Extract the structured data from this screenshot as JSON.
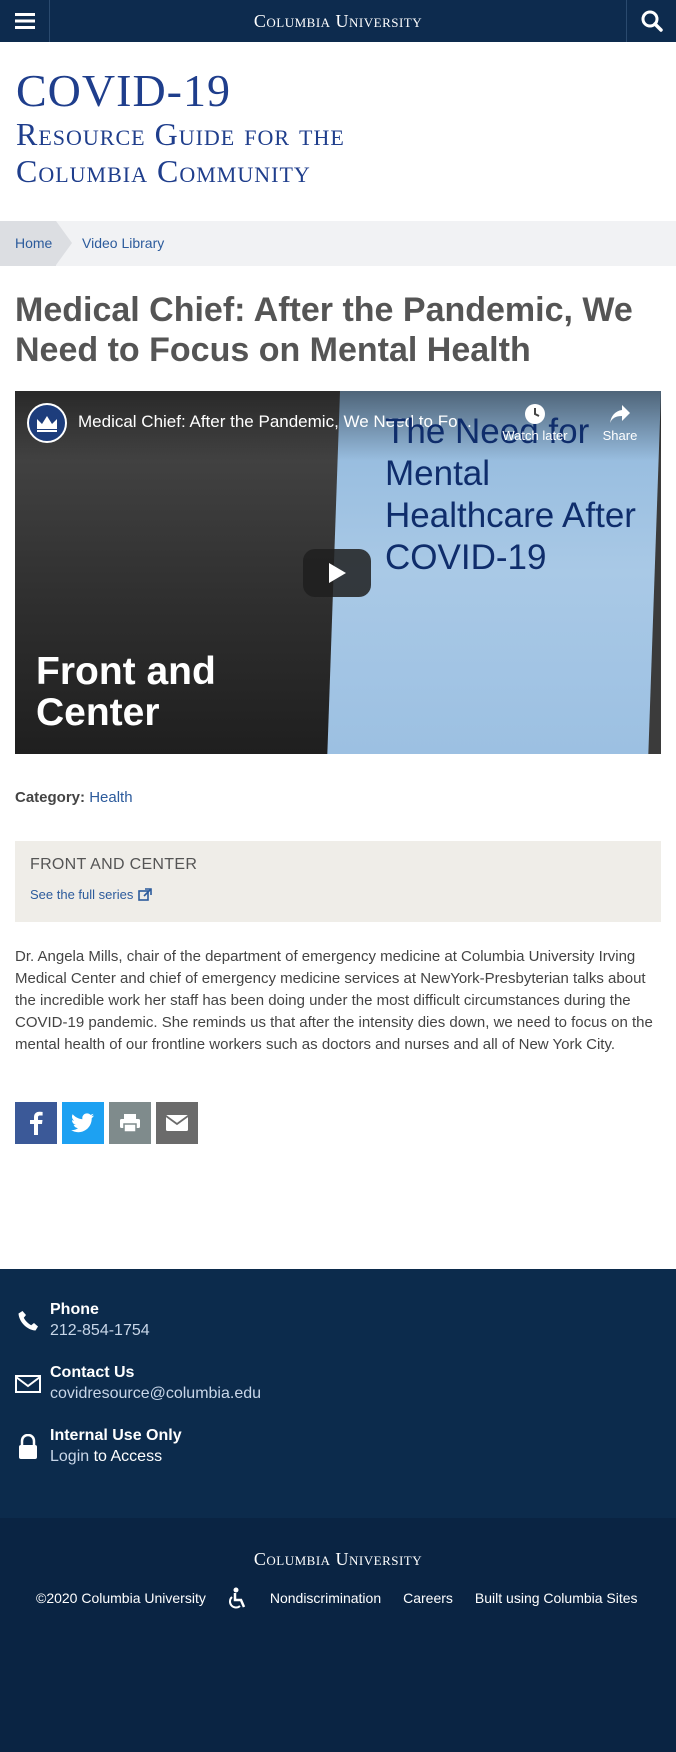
{
  "header": {
    "brand": "Columbia University"
  },
  "site": {
    "title_line1": "COVID-19",
    "title_line2": "Resource Guide for the",
    "title_line3": "Columbia Community"
  },
  "breadcrumb": {
    "home": "Home",
    "current": "Video Library"
  },
  "article": {
    "title": "Medical Chief: After the Pandemic, We Need to Focus on Mental Health",
    "body": "Dr. Angela Mills, chair of the department of emergency medicine at Columbia University Irving Medical Center and chief of emergency medicine services at NewYork-Presbyterian talks about the incredible work her staff has been doing under the most difficult circumstances during the COVID-19 pandemic. She reminds us that after the intensity dies down, we need to focus on the mental health of our frontline workers such as doctors and nurses and all of New York City."
  },
  "video": {
    "title": "Medical Chief: After the Pandemic, We Need to Fo...",
    "watch_later": "Watch later",
    "share": "Share",
    "right_text": "The Need for Mental Healthcare After COVID-19",
    "left_text_1": "Front and",
    "left_text_2": "Center"
  },
  "category": {
    "label": "Category:",
    "value": "Health"
  },
  "series": {
    "heading": "FRONT AND CENTER",
    "link": "See the full series"
  },
  "share_buttons": [
    {
      "icon": "facebook-icon",
      "color": "#3b5998"
    },
    {
      "icon": "twitter-icon",
      "color": "#1da1f2"
    },
    {
      "icon": "print-icon",
      "color": "#7f8b8c"
    },
    {
      "icon": "email-icon",
      "color": "#6b6b6b"
    }
  ],
  "footer": {
    "phone_label": "Phone",
    "phone_value": "212-854-1754",
    "contact_label": "Contact Us",
    "contact_value": "covidresource@columbia.edu",
    "internal_label": "Internal Use Only",
    "internal_login": "Login",
    "internal_suffix": " to Access",
    "brand": "Columbia University",
    "copyright": "©2020 Columbia University",
    "nondiscrimination": "Nondiscrimination",
    "careers": "Careers",
    "built_using": "Built using Columbia Sites"
  }
}
